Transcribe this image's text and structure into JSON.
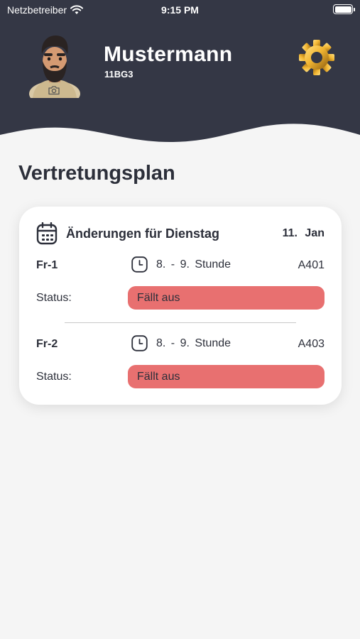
{
  "status_bar": {
    "carrier": "Netzbetreiber",
    "time": "9:15 PM",
    "battery_level": 1.0
  },
  "header": {
    "user_name": "Mustermann",
    "user_class": "11BG3",
    "settings_icon": "gear-icon",
    "background_color": "#343745"
  },
  "page": {
    "title": "Vertretungsplan"
  },
  "card": {
    "icon": "calendar-icon",
    "title": "Änderungen für Dienstag",
    "date": "11. Jan",
    "entries": [
      {
        "course": "Fr-1",
        "period": "8. - 9. Stunde",
        "room": "A401",
        "status_label": "Status:",
        "status": "Fällt aus",
        "status_color": "#e87070"
      },
      {
        "course": "Fr-2",
        "period": "8. - 9. Stunde",
        "room": "A403",
        "status_label": "Status:",
        "status": "Fällt aus",
        "status_color": "#e87070"
      }
    ]
  }
}
